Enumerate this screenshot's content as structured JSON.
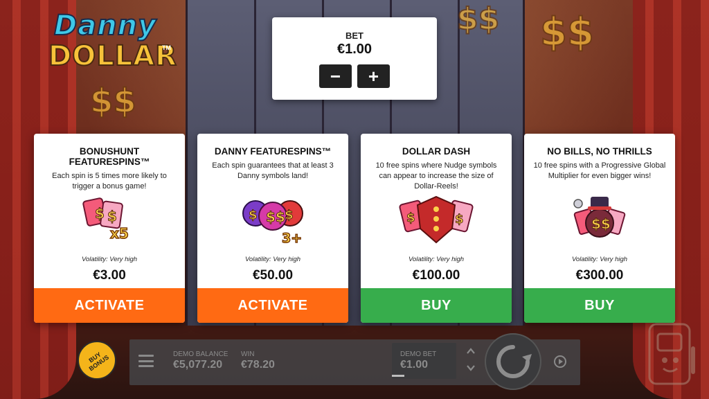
{
  "game": {
    "logo_line1": "Danny",
    "logo_line2": "DOLLAR",
    "logo_tm": "TM"
  },
  "bet_panel": {
    "label": "BET",
    "value": "€1.00",
    "decrease_label": "−",
    "increase_label": "+"
  },
  "cards": [
    {
      "title": "BONUSHUNT FEATURESPINS™",
      "description": "Each spin is 5 times more likely to trigger a bonus game!",
      "art_badge": "x5",
      "volatility": "Volatility: Very high",
      "price": "€3.00",
      "button": "ACTIVATE",
      "button_color": "#ff6a13"
    },
    {
      "title": "DANNY FEATURESPINS™",
      "description": "Each spin guarantees that at least 3 Danny symbols land!",
      "art_badge": "3+",
      "volatility": "Volatility: Very high",
      "price": "€50.00",
      "button": "ACTIVATE",
      "button_color": "#ff6a13"
    },
    {
      "title": "DOLLAR DASH",
      "description": "10 free spins where Nudge symbols can appear to increase the size of Dollar-Reels!",
      "volatility": "Volatility: Very high",
      "price": "€100.00",
      "button": "BUY",
      "button_color": "#37ad4c"
    },
    {
      "title": "NO BILLS, NO THRILLS",
      "description": "10 free spins with a Progressive Global Multiplier for even bigger wins!",
      "volatility": "Volatility: Very high",
      "price": "€300.00",
      "button": "BUY",
      "button_color": "#37ad4c"
    }
  ],
  "bottom_bar": {
    "buy_bonus_label": "BUY BONUS",
    "balance_label": "DEMO BALANCE",
    "balance_value": "€5,077.20",
    "win_label": "WIN",
    "win_value": "€78.20",
    "demo_bet_label": "DEMO BET",
    "demo_bet_value": "€1.00"
  },
  "icons": {
    "menu": "hamburger-menu-icon",
    "spin": "spin-arrow-icon",
    "autoplay": "autoplay-icon",
    "bet_up": "chevron-up-icon",
    "bet_down": "chevron-down-icon",
    "provider": "mascot-logo-icon"
  },
  "colors": {
    "activate": "#ff6a13",
    "buy": "#37ad4c",
    "buy_bonus": "#f4b41a"
  }
}
